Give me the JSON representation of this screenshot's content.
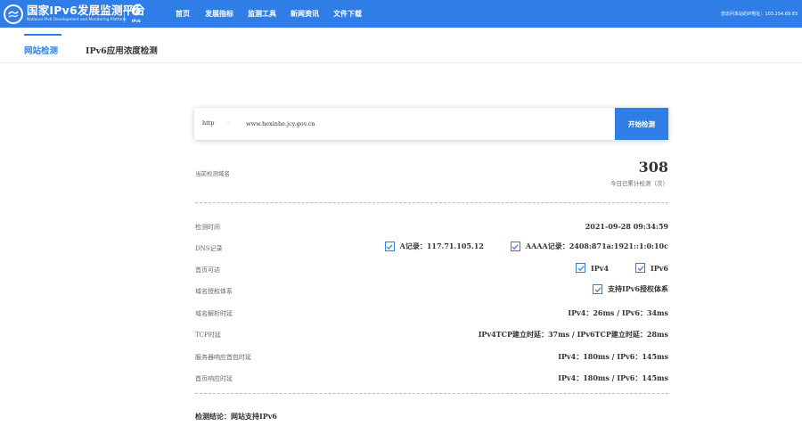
{
  "header": {
    "title": "国家IPv6发展监测平台",
    "subtitle": "National IPv6 Development and Monitoring Platform",
    "mark_glyph": "6",
    "mark_label": "IPv6",
    "nav": [
      "首页",
      "发展指标",
      "监测工具",
      "新闻资讯",
      "文件下载"
    ],
    "ip_info": "您访问本站的IP地址：103.254.69.83"
  },
  "tabs": [
    "网站检测",
    "IPv6应用浓度检测"
  ],
  "search": {
    "protocol": "http",
    "protocol_icon": "chevron-down-icon",
    "domain": "www.hexinhe.jcy.gov.cn",
    "button": "开始检测"
  },
  "summary": {
    "current_label": "当前检测域名",
    "count": "308",
    "count_label": "今日已累计检测（次）"
  },
  "rows": {
    "time": {
      "label": "检测时间",
      "value": "2021-09-28 09:34:59"
    },
    "dns": {
      "label": "DNS记录",
      "a": "A记录：117.71.105.12",
      "aaaa": "AAAA记录：2408:871a:1921::1:0:10c"
    },
    "reach": {
      "label": "首页可达",
      "ipv4": "IPv4",
      "ipv6": "IPv6"
    },
    "auth": {
      "label": "域名授权体系",
      "value": "支持IPv6授权体系"
    },
    "resolve": {
      "label": "域名解析时延",
      "value": "IPv4：26ms / IPv6：34ms"
    },
    "tcp": {
      "label": "TCP时延",
      "value": "IPv4TCP建立时延：37ms / IPv6TCP建立时延：28ms"
    },
    "first_pkg": {
      "label": "服务器响应首包时延",
      "value": "IPv4：180ms / IPv6：145ms"
    },
    "page": {
      "label": "首页响应时延",
      "value": "IPv4：180ms / IPv6：145ms"
    }
  },
  "conclusion": "检测结论：网站支持IPv6",
  "colors": {
    "primary": "#2f7ee8",
    "text": "#333333",
    "label": "#666666"
  }
}
